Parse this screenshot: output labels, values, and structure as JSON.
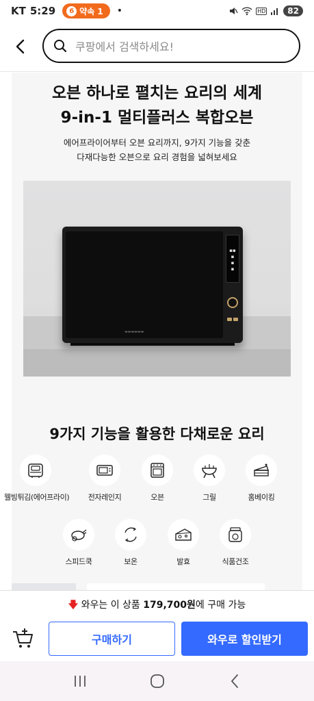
{
  "status_bar": {
    "carrier": "KT",
    "time": "5:29",
    "pill_label": "약속 1",
    "battery": "82",
    "network": "HD"
  },
  "search": {
    "placeholder": "쿠팡에서 검색하세요!"
  },
  "detail": {
    "headline_1": "오븐 하나로 펼치는 요리의 세계",
    "headline_2": "9-in-1 멀티플러스 복합오븐",
    "subline_1": "에어프라이어부터 오븐 요리까지, 9가지 기능을 갖춘",
    "subline_2": "다재다능한 오븐으로 요리 경험을 넓혀보세요",
    "section_title": "9가지 기능을 활용한 다채로운 요리",
    "features": [
      {
        "label": "웰빙튀김(에어프라이)",
        "icon": "air-fryer-icon"
      },
      {
        "label": "전자레인지",
        "icon": "microwave-icon"
      },
      {
        "label": "오븐",
        "icon": "oven-icon"
      },
      {
        "label": "그릴",
        "icon": "grill-icon"
      },
      {
        "label": "홈베이킹",
        "icon": "cake-icon"
      },
      {
        "label": "스피드쿡",
        "icon": "chicken-icon"
      },
      {
        "label": "보온",
        "icon": "circular-arrows-icon"
      },
      {
        "label": "발효",
        "icon": "cheese-icon"
      },
      {
        "label": "식품건조",
        "icon": "dried-fruit-jar-icon"
      }
    ]
  },
  "bottom_bar": {
    "promo_prefix": "와우는 이 상품",
    "promo_price": "179,700원",
    "promo_suffix": "에 구매 가능",
    "buy_label": "구매하기",
    "wow_label": "와우로 할인받기"
  },
  "colors": {
    "accent": "#346aff",
    "promo_arrow": "#e52222",
    "status_pill": "#f26b1d"
  }
}
